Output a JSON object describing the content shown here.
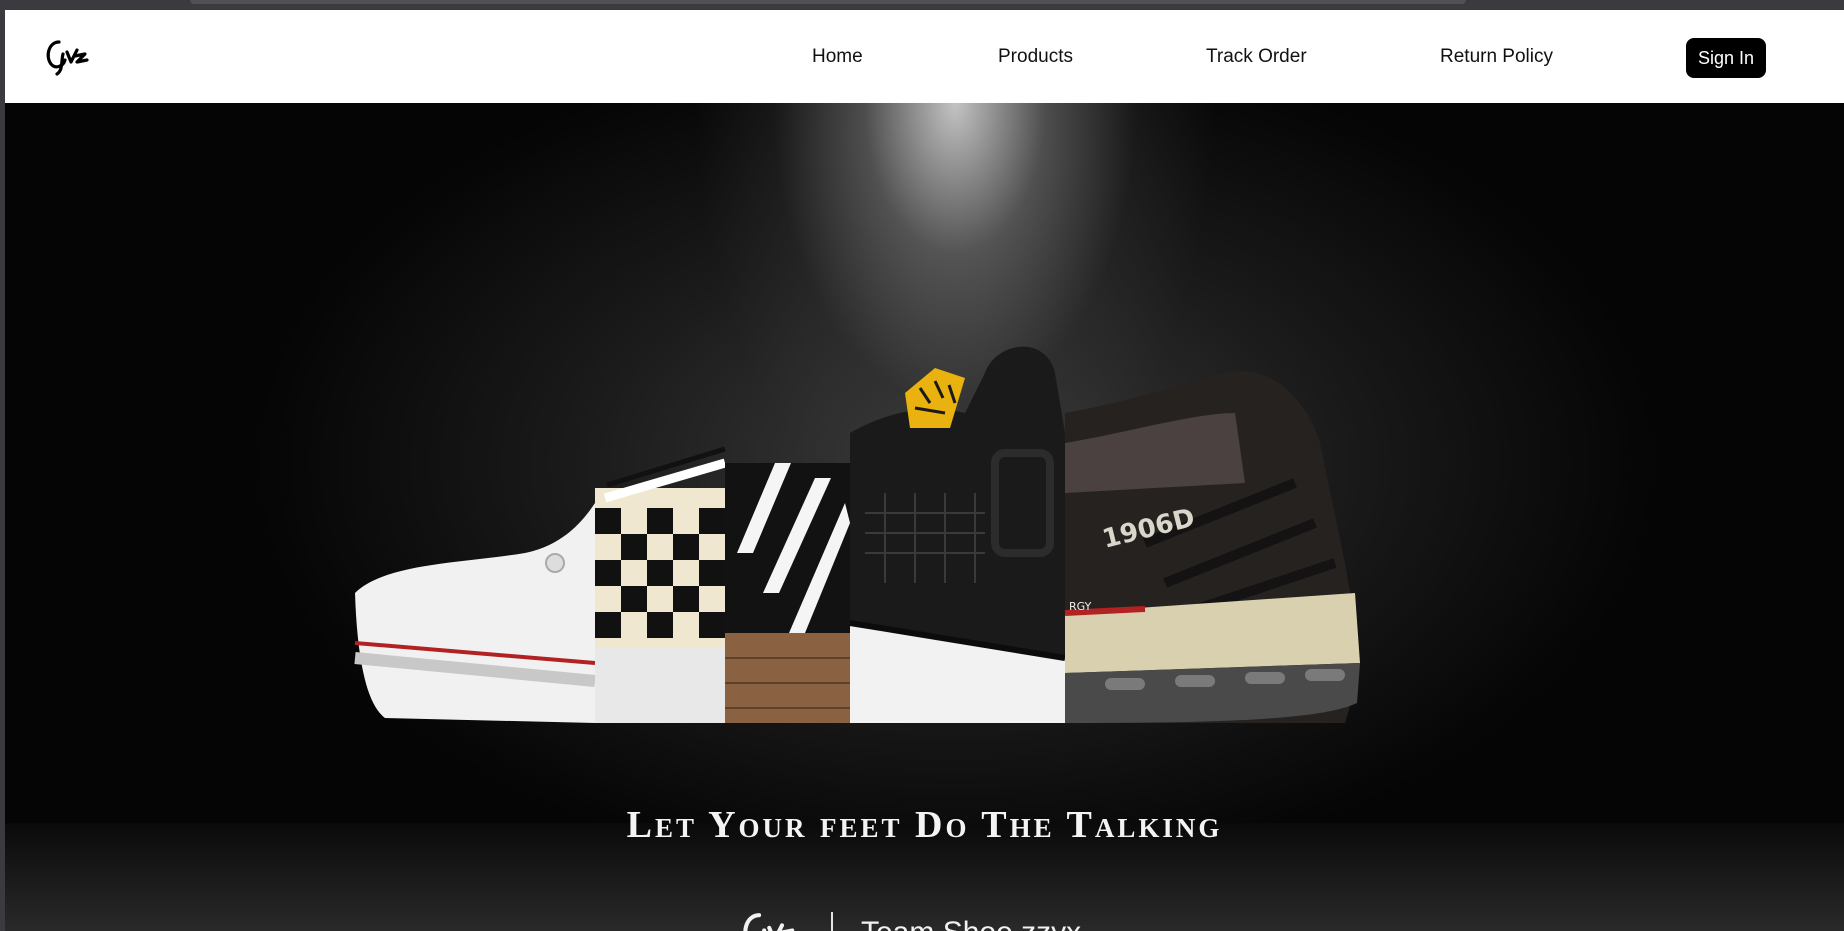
{
  "nav": {
    "logo_text": "Cyz",
    "links": [
      "Home",
      "Products",
      "Track Order",
      "Return Policy"
    ],
    "sign_in": "Sign In"
  },
  "hero": {
    "tagline": "Let Your feet Do The Talking",
    "shoe_model_print": "1906D",
    "sole_print": "RGY",
    "brand_name": "Team Shoe.zzyx"
  },
  "colors": {
    "nav_bg": "#ffffff",
    "button_bg": "#000000",
    "hero_bg": "#0a0a0a",
    "accent_gold": "#e9b20e"
  }
}
